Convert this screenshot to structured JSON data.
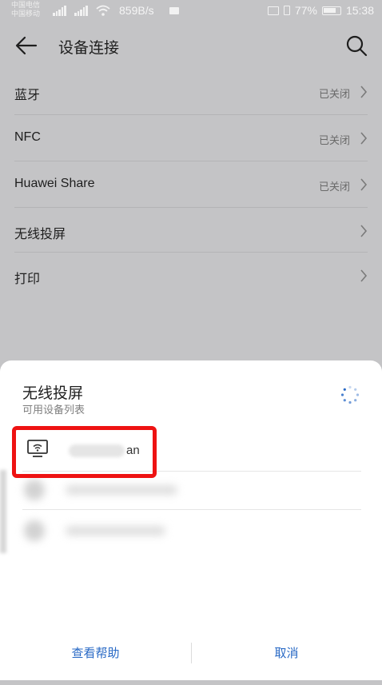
{
  "status_bar": {
    "carrier_1": "中国电信",
    "carrier_2": "中国移动",
    "network_speed": "859B/s",
    "battery": "77%",
    "time": "15:38"
  },
  "app_bar": {
    "title": "设备连接",
    "back_icon": "arrow-left",
    "search_icon": "magnifier"
  },
  "settings": {
    "items": [
      {
        "label": "蓝牙",
        "value": "已关闭"
      },
      {
        "label": "NFC",
        "value": "已关闭"
      },
      {
        "label": "Huawei Share",
        "value": "已关闭"
      },
      {
        "label": "无线投屏",
        "value": ""
      },
      {
        "label": "打印",
        "value": ""
      }
    ]
  },
  "sheet": {
    "title": "无线投屏",
    "subtitle": "可用设备列表",
    "devices": [
      {
        "name_visible_suffix": "an",
        "icon": "monitor-wifi"
      }
    ],
    "help_button": "查看帮助",
    "cancel_button": "取消"
  },
  "colors": {
    "accent": "#2869c5",
    "highlight": "#ee1212",
    "dim_background": "#c4c4c6"
  }
}
